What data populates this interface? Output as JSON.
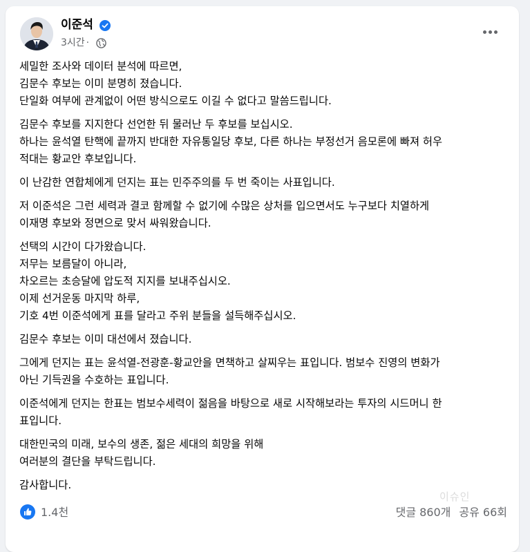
{
  "post": {
    "author": "이준석",
    "time": "3시간",
    "separator": "·",
    "paragraphs": [
      [
        "세밀한 조사와 데이터 분석에 따르면,",
        "김문수 후보는 이미 분명히 졌습니다.",
        "단일화 여부에 관계없이 어떤 방식으로도 이길 수 없다고 말씀드립니다."
      ],
      [
        "김문수 후보를 지지한다 선언한 뒤 물러난 두 후보를 보십시오.",
        "하나는 윤석열 탄핵에 끝까지 반대한 자유통일당 후보, 다른 하나는 부정선거 음모론에 빠져 허우",
        "적대는 황교안 후보입니다."
      ],
      [
        "이 난감한 연합체에게 던지는 표는 민주주의를 두 번 죽이는 사표입니다."
      ],
      [
        "저 이준석은 그런 세력과 결코 함께할 수 없기에 수많은 상처를 입으면서도 누구보다 치열하게",
        "이재명 후보와 정면으로 맞서 싸워왔습니다."
      ],
      [
        "선택의 시간이 다가왔습니다.",
        "저무는 보름달이 아니라,",
        "차오르는 초승달에 압도적 지지를 보내주십시오.",
        "이제 선거운동 마지막 하루,",
        "기호 4번 이준석에게 표를 달라고 주위 분들을 설득해주십시오."
      ],
      [
        "김문수 후보는 이미 대선에서 졌습니다."
      ],
      [
        "그에게 던지는 표는 윤석열-전광훈-황교안을 면책하고 살찌우는 표입니다. 범보수 진영의 변화가",
        "아닌 기득권을 수호하는 표입니다."
      ],
      [
        "이준석에게 던지는 한표는 범보수세력이 젊음을 바탕으로 새로 시작해보라는 투자의 시드머니 한",
        "표입니다."
      ],
      [
        "대한민국의 미래, 보수의 생존, 젊은 세대의 희망을 위해",
        "여러분의 결단을 부탁드립니다."
      ],
      [
        "감사합니다."
      ]
    ],
    "reactions": "1.4천",
    "comments": "댓글 860개",
    "shares": "공유 66회",
    "watermark": "이슈인"
  },
  "icons": {
    "verified": "verified-badge-icon",
    "privacy": "globe-icon",
    "more": "more-options-icon",
    "like": "like-icon"
  },
  "colors": {
    "accent": "#1877f2",
    "text": "#050505",
    "secondary": "#65676b",
    "background": "#f0f2f5"
  }
}
